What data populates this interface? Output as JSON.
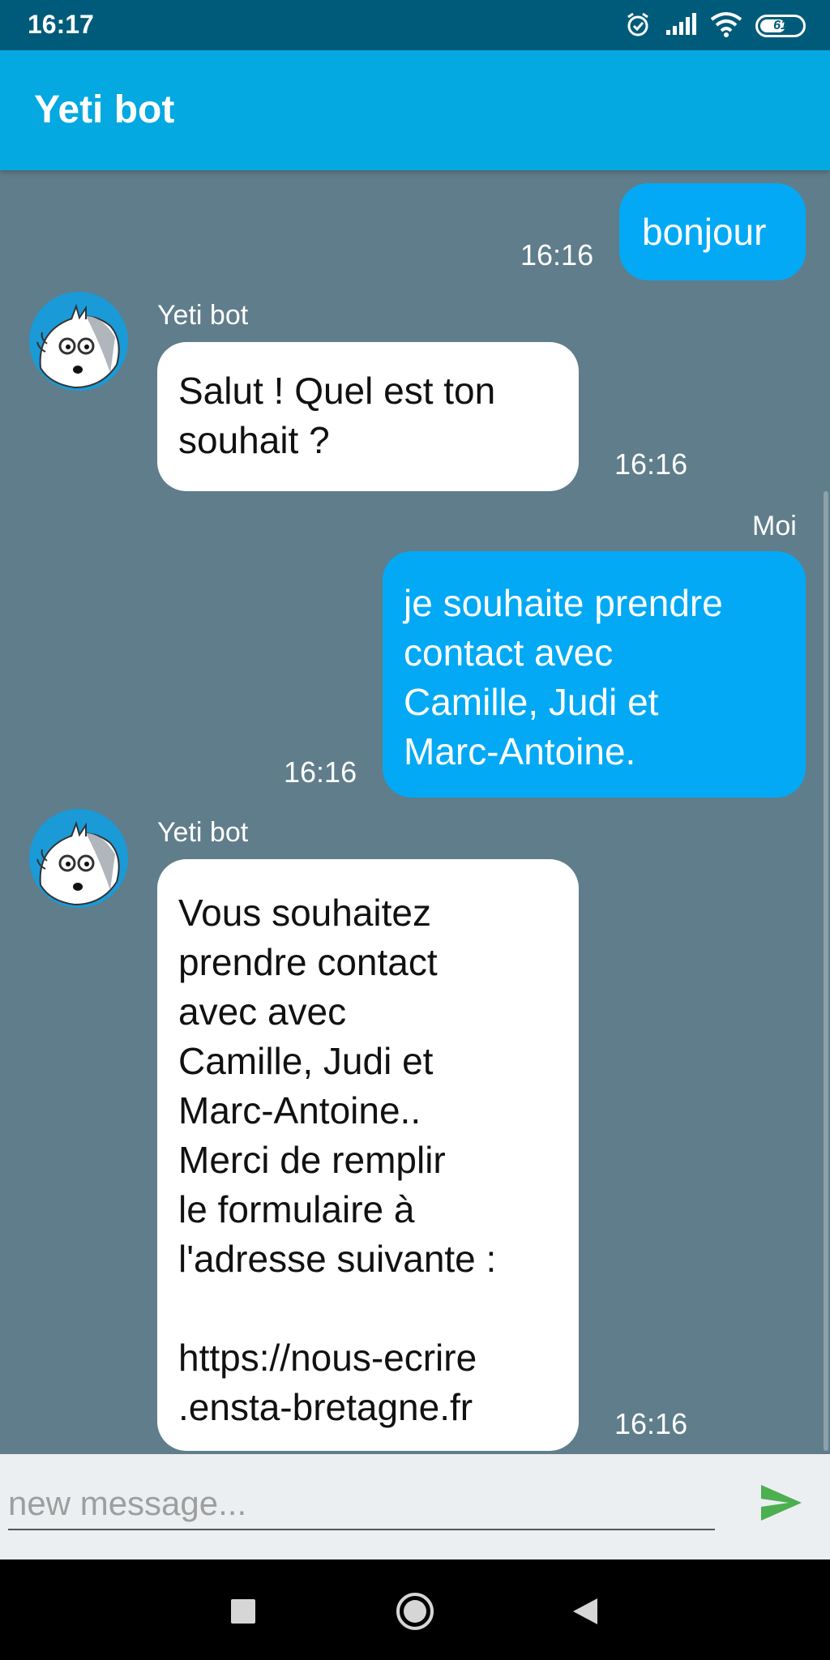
{
  "status_bar": {
    "time": "16:17",
    "battery": "61",
    "battery_level": 0.61
  },
  "app_bar": {
    "title": "Yeti bot"
  },
  "colors": {
    "status_bar": "#005b7a",
    "app_bar": "#03a9e0",
    "chat_background": "#607d8b",
    "user_bubble": "#03a9f4",
    "bot_bubble": "#ffffff",
    "send_icon": "#4caf50"
  },
  "messages": [
    {
      "from": "user",
      "sender": "",
      "text": "bonjour",
      "time": "16:16"
    },
    {
      "from": "bot",
      "sender": "Yeti bot",
      "text": "Salut !  Quel est ton\nsouhait ?",
      "time": "16:16",
      "avatar_icon": "yeti-avatar-icon"
    },
    {
      "from": "user",
      "sender": "Moi",
      "text": "je souhaite prendre\ncontact avec\nCamille, Judi et\nMarc-Antoine.",
      "time": "16:16"
    },
    {
      "from": "bot",
      "sender": "Yeti bot",
      "text": "Vous souhaitez\nprendre contact\navec avec\nCamille, Judi et\nMarc-Antoine..\nMerci de remplir\nle formulaire à\nl'adresse suivante :\n\nhttps://nous-ecrire\n.ensta-bretagne.fr",
      "time": "16:16",
      "avatar_icon": "yeti-avatar-icon"
    }
  ],
  "composer": {
    "placeholder": "new message...",
    "value": "",
    "send_icon": "send-icon"
  },
  "nav": {
    "recents_icon": "square-icon",
    "home_icon": "circle-icon",
    "back_icon": "triangle-back-icon"
  }
}
